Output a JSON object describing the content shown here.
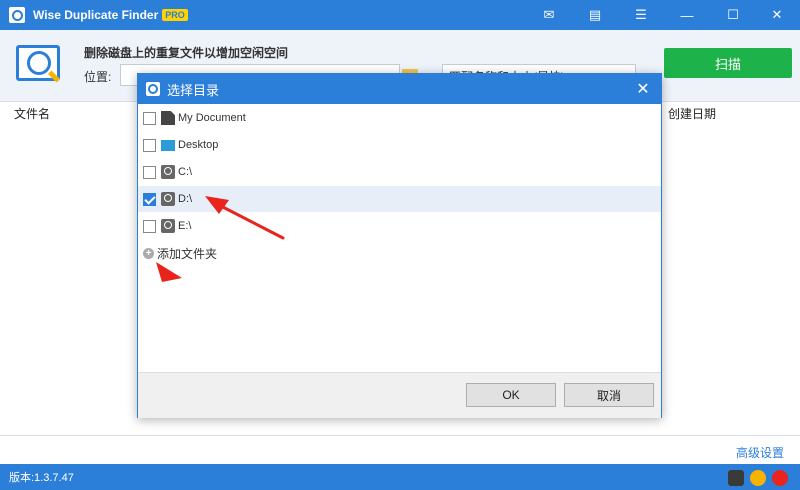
{
  "window": {
    "title": "Wise Duplicate Finder",
    "badge": "PRO",
    "controls": [
      "✉",
      "▤",
      "☰",
      "—",
      "☐",
      "✕"
    ]
  },
  "header": {
    "title": "删除磁盘上的重复文件以增加空闲空间",
    "location_label": "位置:",
    "match_option": "匹配名称和大小(最快)",
    "scan_label": "扫描"
  },
  "table": {
    "col_name": "文件名",
    "col_date": "创建日期"
  },
  "dialog": {
    "title": "选择目录",
    "close": "✕",
    "items": [
      {
        "label": "My Document",
        "checked": false,
        "icon": "document-icon"
      },
      {
        "label": "Desktop",
        "checked": false,
        "icon": "desktop-icon"
      },
      {
        "label": "C:\\",
        "checked": false,
        "icon": "drive-icon"
      },
      {
        "label": "D:\\",
        "checked": true,
        "icon": "drive-icon"
      },
      {
        "label": "E:\\",
        "checked": false,
        "icon": "drive-icon"
      }
    ],
    "add_folder": "添加文件夹",
    "ok": "OK",
    "cancel": "取消"
  },
  "footer": {
    "link": "高级设置",
    "version": "版本:1.3.7.47"
  },
  "colors": {
    "accent": "#2c7fd9",
    "scan_green": "#1db34a",
    "arrow_red": "#e8241c"
  }
}
